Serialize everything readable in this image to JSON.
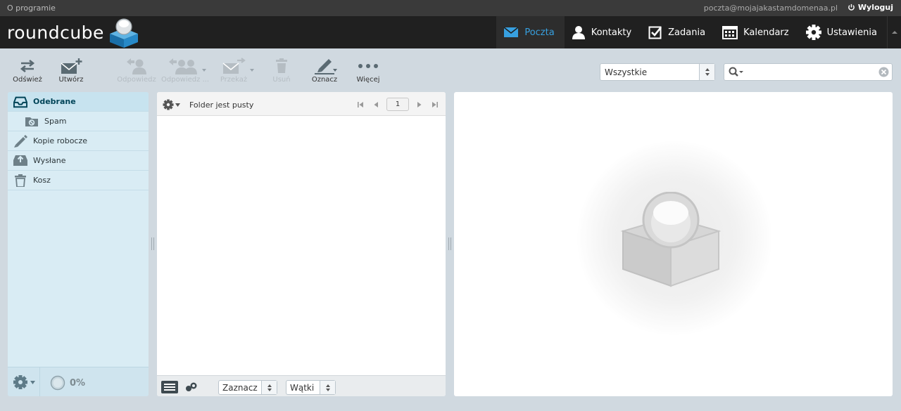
{
  "topbar": {
    "about": "O programie",
    "user_email": "poczta@mojajakastamdomenaa.pl",
    "logout": "Wyloguj"
  },
  "brand": {
    "logo_text": "roundcube"
  },
  "nav": [
    {
      "label": "Poczta",
      "icon": "mail-icon",
      "selected": true
    },
    {
      "label": "Kontakty",
      "icon": "contact-icon"
    },
    {
      "label": "Zadania",
      "icon": "tasks-icon"
    },
    {
      "label": "Kalendarz",
      "icon": "calendar-icon"
    },
    {
      "label": "Ustawienia",
      "icon": "gear-icon"
    }
  ],
  "toolbar": {
    "refresh": "Odśwież",
    "compose": "Utwórz",
    "reply": "Odpowiedz",
    "reply_all": "Odpowiedz ...",
    "forward": "Przekaż",
    "delete": "Usuń",
    "mark": "Oznacz",
    "more": "Więcej"
  },
  "filter": {
    "value": "Wszystkie"
  },
  "search": {
    "placeholder": ""
  },
  "folders": [
    {
      "name": "Odebrane",
      "icon": "inbox-icon",
      "selected": true
    },
    {
      "name": "Spam",
      "icon": "spam-icon",
      "sub": true
    },
    {
      "name": "Kopie robocze",
      "icon": "drafts-icon"
    },
    {
      "name": "Wysłane",
      "icon": "sent-icon"
    },
    {
      "name": "Kosz",
      "icon": "trash-icon"
    }
  ],
  "quota": "0%",
  "messagelist": {
    "status": "Folder jest pusty",
    "page": "1",
    "select_label": "Zaznacz",
    "threads_label": "Wątki"
  },
  "colors": {
    "accent": "#37a0e0",
    "header_bg": "#202020",
    "folder_bg": "#d9ecf4",
    "selected_folder": "#c7e3ef"
  }
}
